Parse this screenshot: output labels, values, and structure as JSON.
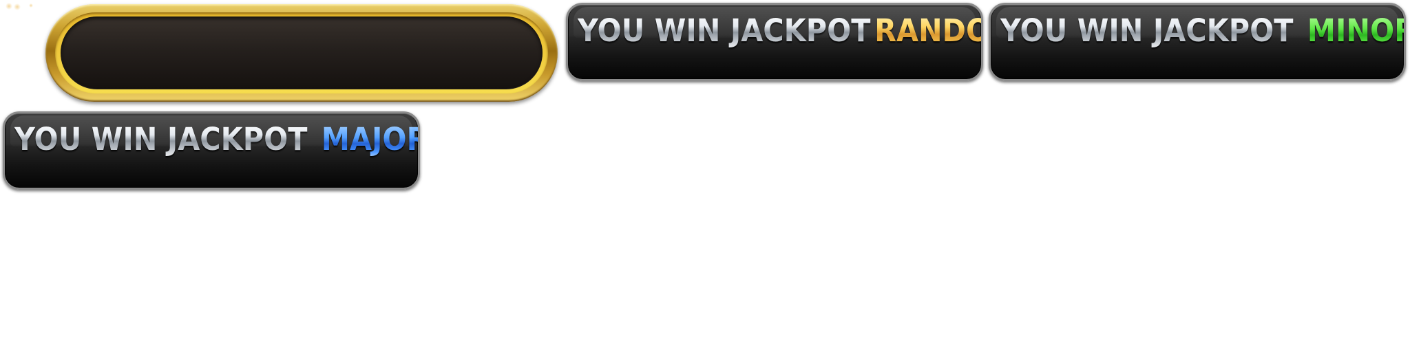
{
  "sprites": {
    "gold_frame": {
      "name": "empty-gold-frame"
    },
    "banners": [
      {
        "lead": "YOU WIN JACKPOT",
        "tier": "RANDOM",
        "tier_color": "#f4c24a"
      },
      {
        "lead": "YOU WIN JACKPOT",
        "tier": "MINOR",
        "tier_color": "#4de038"
      },
      {
        "lead": "YOU WIN JACKPOT",
        "tier": "MAJOR",
        "tier_color": "#3d8cff"
      }
    ]
  },
  "colors": {
    "gold": "#d9a92e",
    "banner_bg": "#111111",
    "silver_text": "#c9cfd6"
  }
}
